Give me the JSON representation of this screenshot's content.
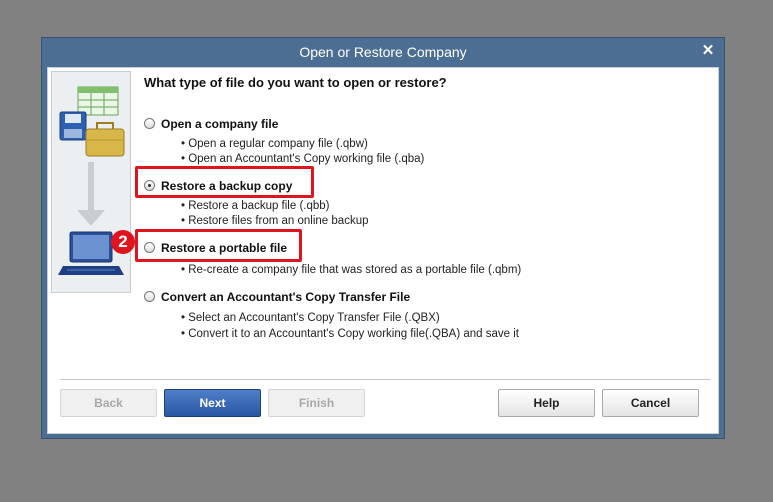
{
  "window": {
    "title": "Open or Restore Company"
  },
  "question": "What type of file do you want to open or restore?",
  "options": [
    {
      "label": "Open a company file",
      "checked": false,
      "details": [
        "• Open a regular company file (.qbw)",
        "• Open an Accountant's Copy working file (.qba)"
      ]
    },
    {
      "label": "Restore a backup copy",
      "checked": true,
      "details": [
        "• Restore a backup file (.qbb)",
        "• Restore files from an online backup"
      ]
    },
    {
      "label": "Restore a portable file",
      "checked": false,
      "details": [
        "• Re-create a company file that was stored as a portable file (.qbm)"
      ]
    },
    {
      "label": "Convert an Accountant's Copy Transfer File",
      "checked": false,
      "details": [
        "• Select an Accountant's Copy Transfer File (.QBX)",
        "• Convert it to an Accountant's Copy working file(.QBA) and save it"
      ]
    }
  ],
  "annotation": {
    "step": "2",
    "color": "#e0141e"
  },
  "buttons": {
    "back": "Back",
    "next": "Next",
    "finish": "Finish",
    "help": "Help",
    "cancel": "Cancel"
  },
  "colors": {
    "titlebar": "#4d6e93",
    "primary": "#2a57a5",
    "highlight": "#e0141e"
  },
  "icons": [
    "close-icon",
    "spreadsheet-icon",
    "floppy-disk-icon",
    "briefcase-icon",
    "arrow-down-icon",
    "laptop-icon"
  ]
}
